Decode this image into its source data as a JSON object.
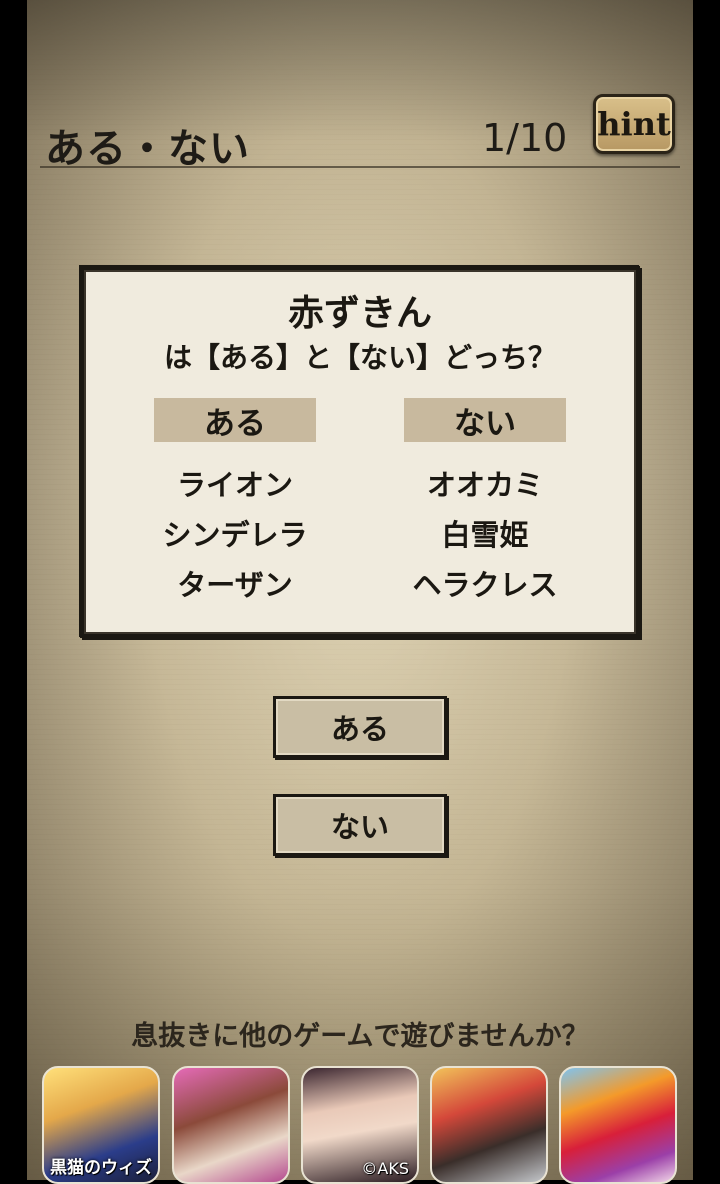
{
  "header": {
    "title": "ある・ない",
    "progress": "1/10",
    "hint_label": "hint"
  },
  "question": {
    "subject": "赤ずきん",
    "text": "は【ある】と【ない】どっち？"
  },
  "columns": {
    "aru": {
      "header": "ある",
      "items": [
        "ライオン",
        "シンデレラ",
        "ターザン"
      ]
    },
    "nai": {
      "header": "ない",
      "items": [
        "オオカミ",
        "白雪姫",
        "ヘラクレス"
      ]
    }
  },
  "answers": {
    "aru_label": "ある",
    "nai_label": "ない"
  },
  "ads": {
    "title": "息抜きに他のゲームで遊びませんか？",
    "apps": [
      {
        "label": "黒猫のウィズ",
        "icon": "black-cat-wiz-app-icon"
      },
      {
        "label": "",
        "icon": "romance-game-app-icon"
      },
      {
        "label": "©AKS",
        "icon": "idol-game-app-icon"
      },
      {
        "label": "",
        "icon": "rock-game-app-icon"
      },
      {
        "label": "",
        "icon": "candy-crush-app-icon"
      }
    ]
  }
}
